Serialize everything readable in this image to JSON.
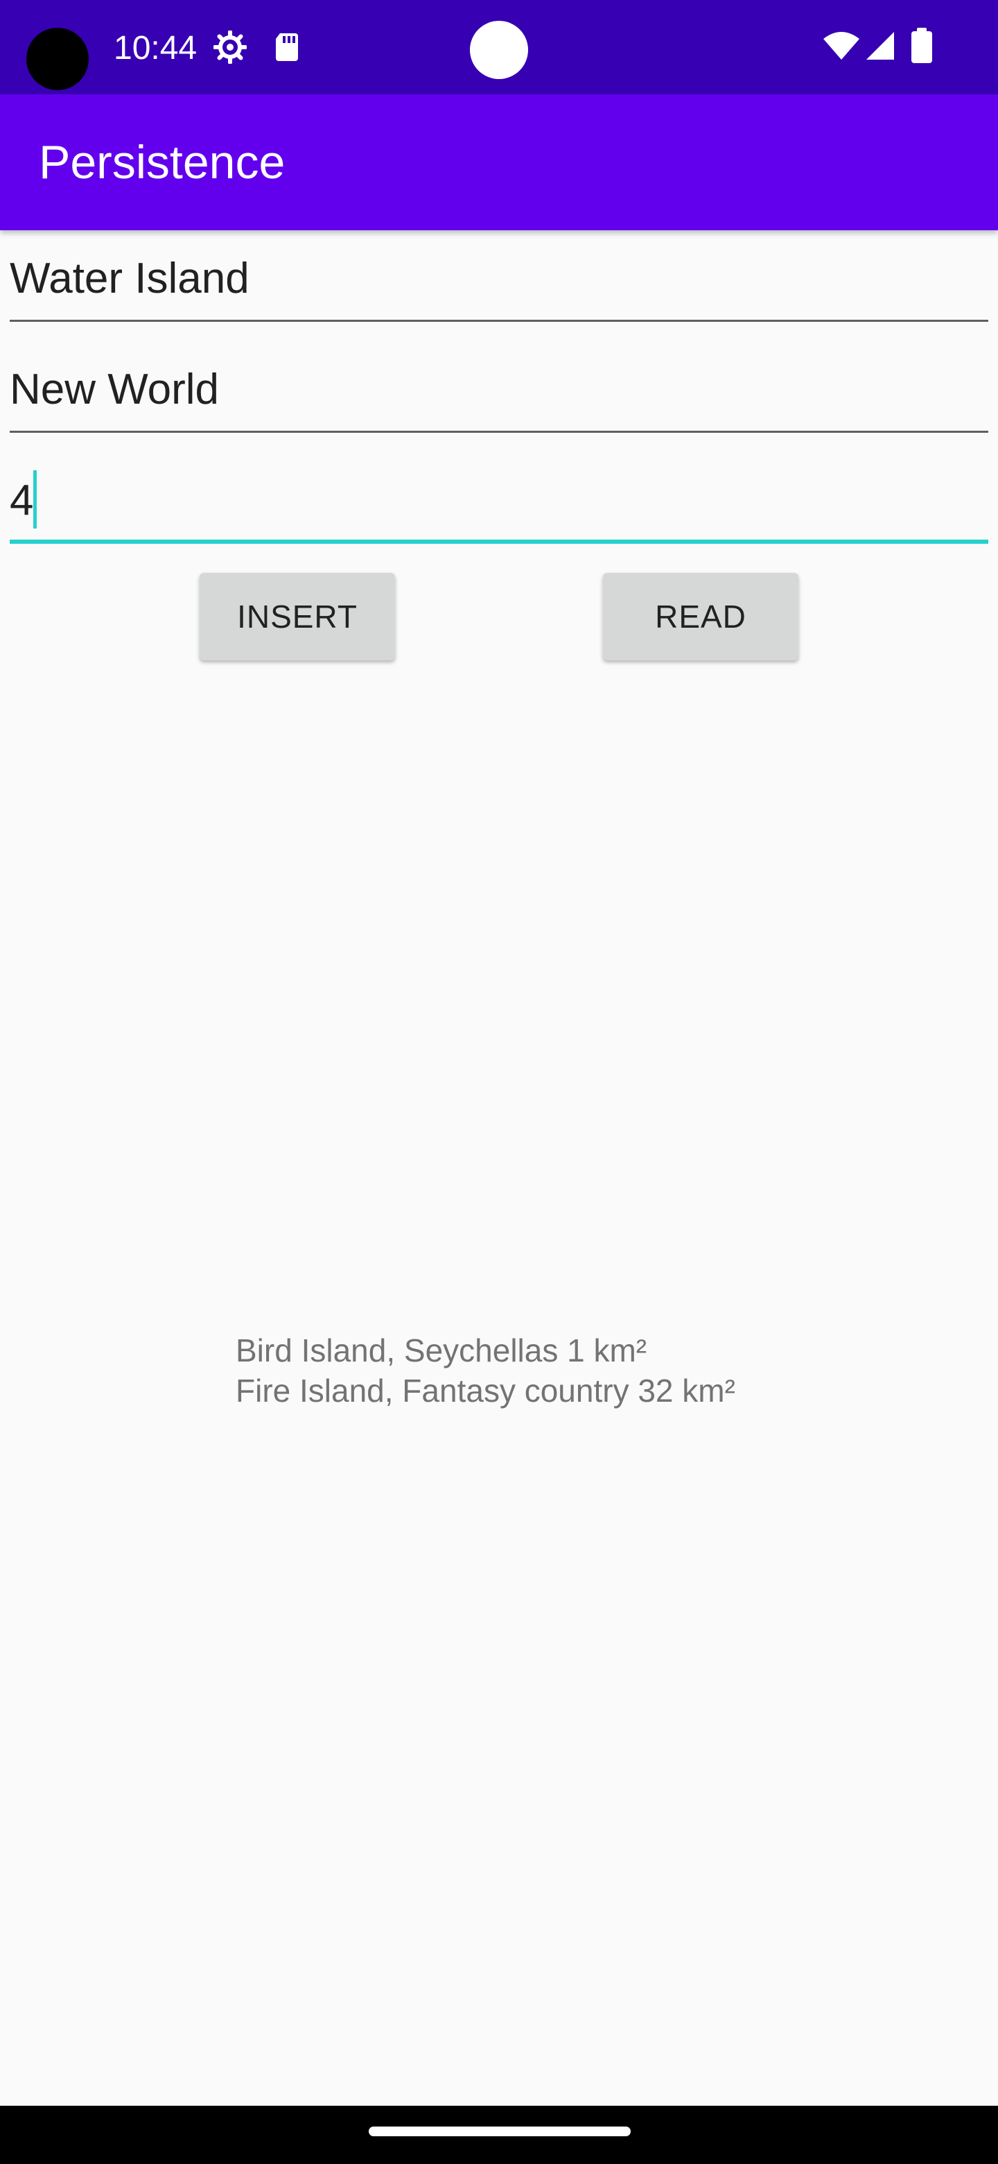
{
  "status_bar": {
    "time": "10:44",
    "icons": [
      "settings-gear-icon",
      "sd-card-icon",
      "wifi-icon",
      "cell-signal-icon",
      "battery-icon"
    ],
    "background": "#3700b3"
  },
  "app_bar": {
    "title": "Persistence",
    "background": "#6200ee"
  },
  "form": {
    "name_value": "Water Island",
    "country_value": "New World",
    "area_value": "4",
    "accent": "#26d0ce"
  },
  "buttons": {
    "insert_label": "INSERT",
    "read_label": "READ"
  },
  "output": {
    "lines": [
      "Bird Island, Seychellas 1 km²",
      "Fire Island, Fantasy country 32 km²"
    ]
  }
}
